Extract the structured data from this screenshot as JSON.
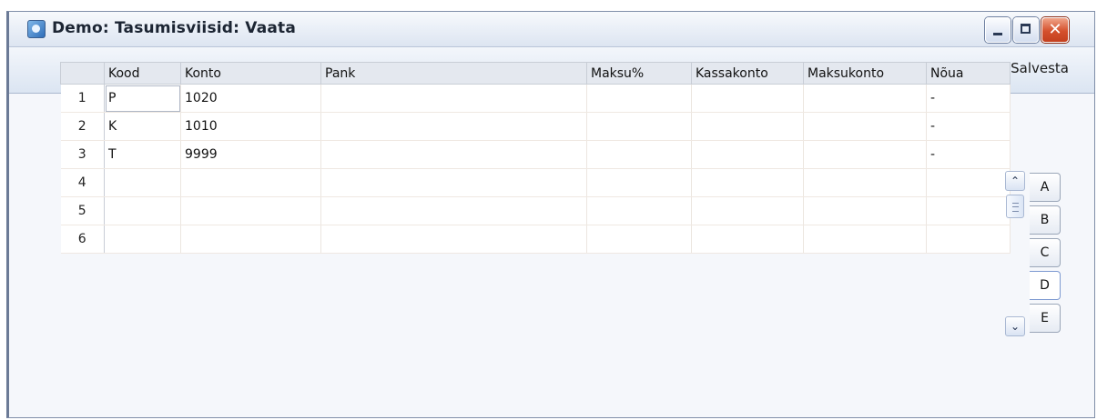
{
  "window": {
    "title": "Demo: Tasumisviisid: Vaata",
    "app_icon": "app-icon",
    "controls": {
      "minimize": "minimize-icon",
      "maximize": "maximize-icon",
      "close": "close-icon",
      "close_glyph": "✕"
    }
  },
  "toolbar": {
    "save_label": "Salvesta"
  },
  "grid": {
    "columns": [
      "",
      "Kood",
      "Konto",
      "Pank",
      "Maksu%",
      "Kassakonto",
      "Maksukonto",
      "Nõua"
    ],
    "rows": [
      [
        "1",
        "P",
        "1020",
        "",
        "",
        "",
        "",
        "-"
      ],
      [
        "2",
        "K",
        "1010",
        "",
        "",
        "",
        "",
        "-"
      ],
      [
        "3",
        "T",
        "9999",
        "",
        "",
        "",
        "",
        "-"
      ],
      [
        "4",
        "",
        "",
        "",
        "",
        "",
        "",
        ""
      ],
      [
        "5",
        "",
        "",
        "",
        "",
        "",
        "",
        ""
      ],
      [
        "6",
        "",
        "",
        "",
        "",
        "",
        "",
        ""
      ]
    ]
  },
  "scrollbar": {
    "up_glyph": "⌃",
    "down_glyph": "⌄"
  },
  "tabs": [
    {
      "label": "A",
      "selected": false
    },
    {
      "label": "B",
      "selected": false
    },
    {
      "label": "C",
      "selected": false
    },
    {
      "label": "D",
      "selected": true
    },
    {
      "label": "E",
      "selected": false
    }
  ]
}
